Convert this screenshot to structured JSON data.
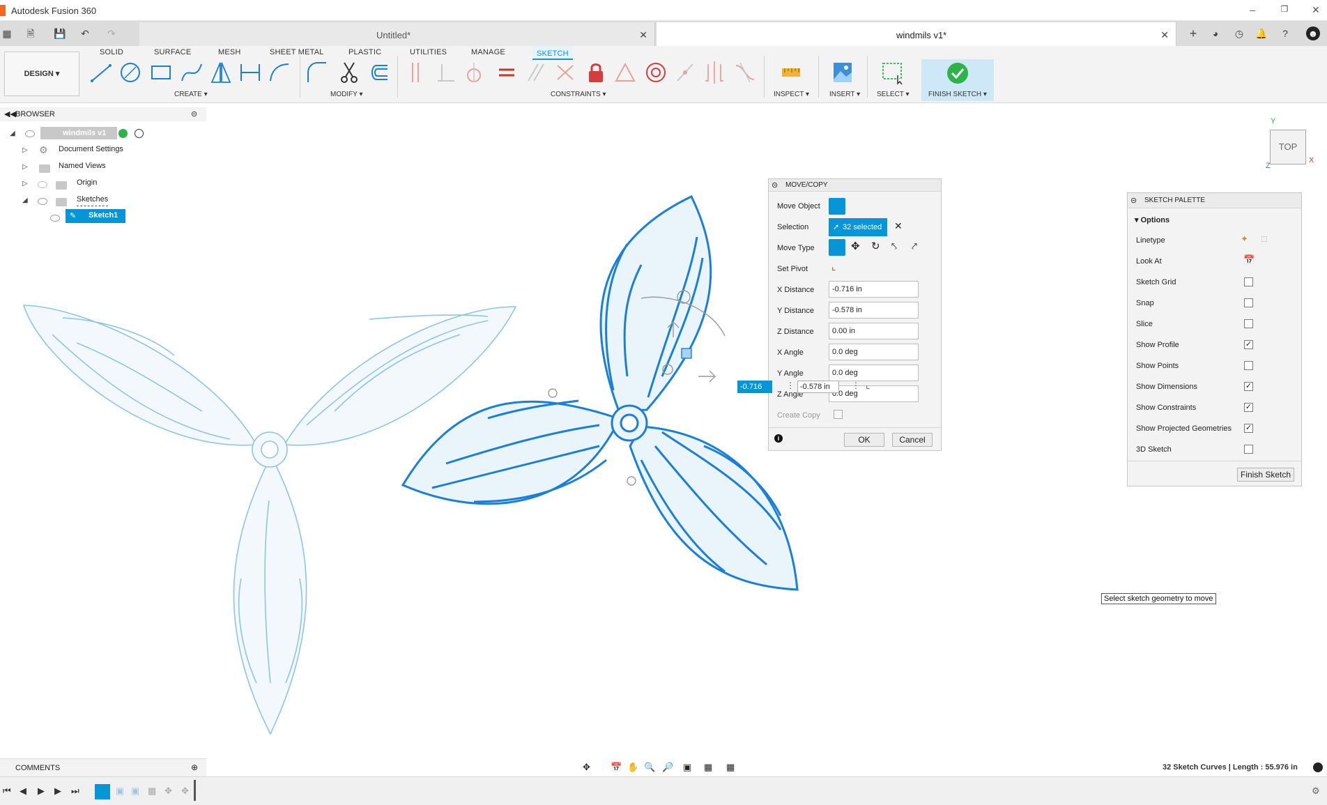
{
  "app": {
    "title": "Autodesk Fusion 360"
  },
  "tabs": [
    {
      "label": "Untitled*",
      "active": false
    },
    {
      "label": "windmils v1*",
      "active": true
    }
  ],
  "ribbon": {
    "workspace": "DESIGN",
    "tabs": [
      "SOLID",
      "SURFACE",
      "MESH",
      "SHEET METAL",
      "PLASTIC",
      "UTILITIES",
      "MANAGE",
      "SKETCH"
    ],
    "active_tab": "SKETCH",
    "groups": {
      "create": "CREATE",
      "modify": "MODIFY",
      "constraints": "CONSTRAINTS",
      "inspect": "INSPECT",
      "insert": "INSERT",
      "select": "SELECT",
      "finish": "FINISH SKETCH"
    }
  },
  "browser": {
    "header": "BROWSER",
    "root": "windmils v1",
    "items": [
      "Document Settings",
      "Named Views",
      "Origin",
      "Sketches",
      "Sketch1"
    ]
  },
  "movecopy": {
    "title": "MOVE/COPY",
    "move_object_label": "Move Object",
    "selection_label": "Selection",
    "selection_value": "32 selected",
    "move_type_label": "Move Type",
    "set_pivot_label": "Set Pivot",
    "x_distance_label": "X Distance",
    "x_distance": "-0.716 in",
    "y_distance_label": "Y Distance",
    "y_distance": "-0.578 in",
    "z_distance_label": "Z Distance",
    "z_distance": "0.00 in",
    "x_angle_label": "X Angle",
    "x_angle": "0.0 deg",
    "y_angle_label": "Y Angle",
    "y_angle": "0.0 deg",
    "z_angle_label": "Z Angle",
    "z_angle": "0.0 deg",
    "create_copy_label": "Create Copy",
    "ok": "OK",
    "cancel": "Cancel"
  },
  "float_inputs": {
    "x": "-0.716 in",
    "y": "-0.578 in"
  },
  "palette": {
    "title": "SKETCH PALETTE",
    "section": "Options",
    "rows": [
      {
        "label": "Linetype"
      },
      {
        "label": "Look At"
      },
      {
        "label": "Sketch Grid",
        "checked": false
      },
      {
        "label": "Snap",
        "checked": false
      },
      {
        "label": "Slice",
        "checked": false
      },
      {
        "label": "Show Profile",
        "checked": true
      },
      {
        "label": "Show Points",
        "checked": false
      },
      {
        "label": "Show Dimensions",
        "checked": true
      },
      {
        "label": "Show Constraints",
        "checked": true
      },
      {
        "label": "Show Projected Geometries",
        "checked": true
      },
      {
        "label": "3D Sketch",
        "checked": false
      }
    ],
    "finish_button": "Finish Sketch"
  },
  "tooltip": "Select sketch geometry to move",
  "viewcube": {
    "face": "TOP",
    "axes": [
      "Y",
      "X",
      "Z"
    ]
  },
  "comments": "COMMENTS",
  "status": "32 Sketch Curves | Length : 55.976 in",
  "colors": {
    "accent": "#0696d7",
    "sketch_blue": "#1a7fd9",
    "faded_blue": "#7fc3e6",
    "fill": "#eaf4fb",
    "finish_green": "#2cb34a"
  }
}
